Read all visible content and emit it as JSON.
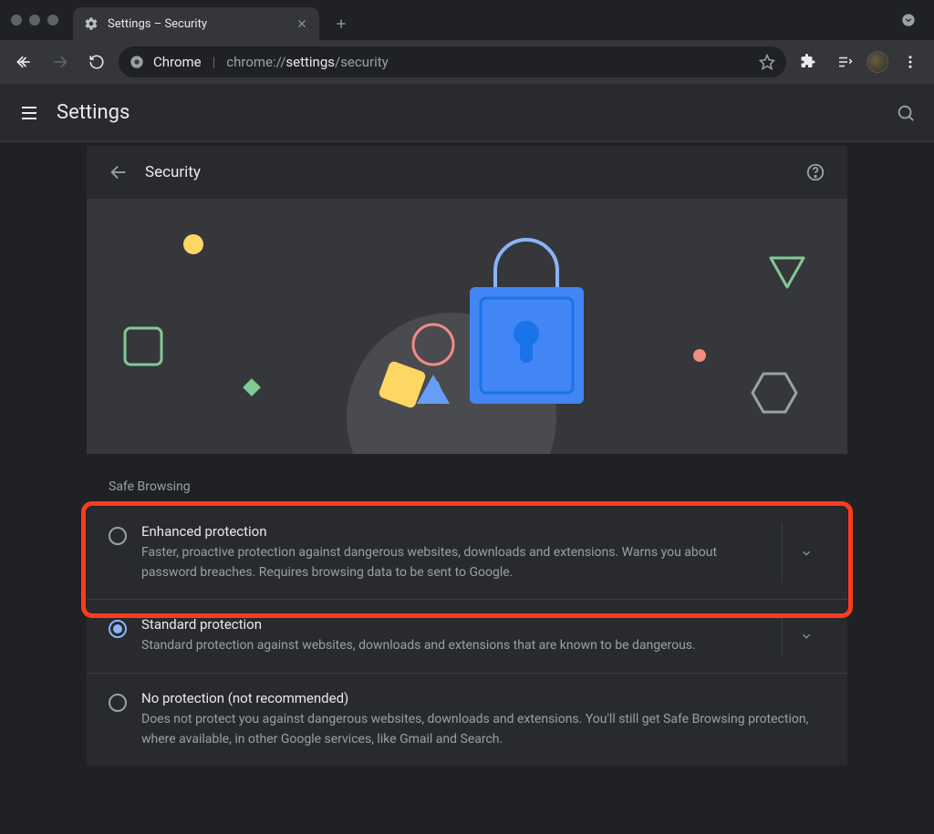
{
  "window": {
    "tab_title": "Settings – Security"
  },
  "toolbar": {
    "product": "Chrome",
    "url_dim1": "chrome://",
    "url_bright": "settings",
    "url_dim2": "/security"
  },
  "settings_bar": {
    "title": "Settings"
  },
  "section": {
    "title": "Security"
  },
  "safe_browsing": {
    "group_label": "Safe Browsing",
    "options": [
      {
        "title": "Enhanced protection",
        "desc": "Faster, proactive protection against dangerous websites, downloads and extensions. Warns you about password breaches. Requires browsing data to be sent to Google.",
        "selected": false,
        "expandable": true
      },
      {
        "title": "Standard protection",
        "desc": "Standard protection against websites, downloads and extensions that are known to be dangerous.",
        "selected": true,
        "expandable": true
      },
      {
        "title": "No protection (not recommended)",
        "desc": "Does not protect you against dangerous websites, downloads and extensions. You'll still get Safe Browsing protection, where available, in other Google services, like Gmail and Search.",
        "selected": false,
        "expandable": false
      }
    ]
  }
}
